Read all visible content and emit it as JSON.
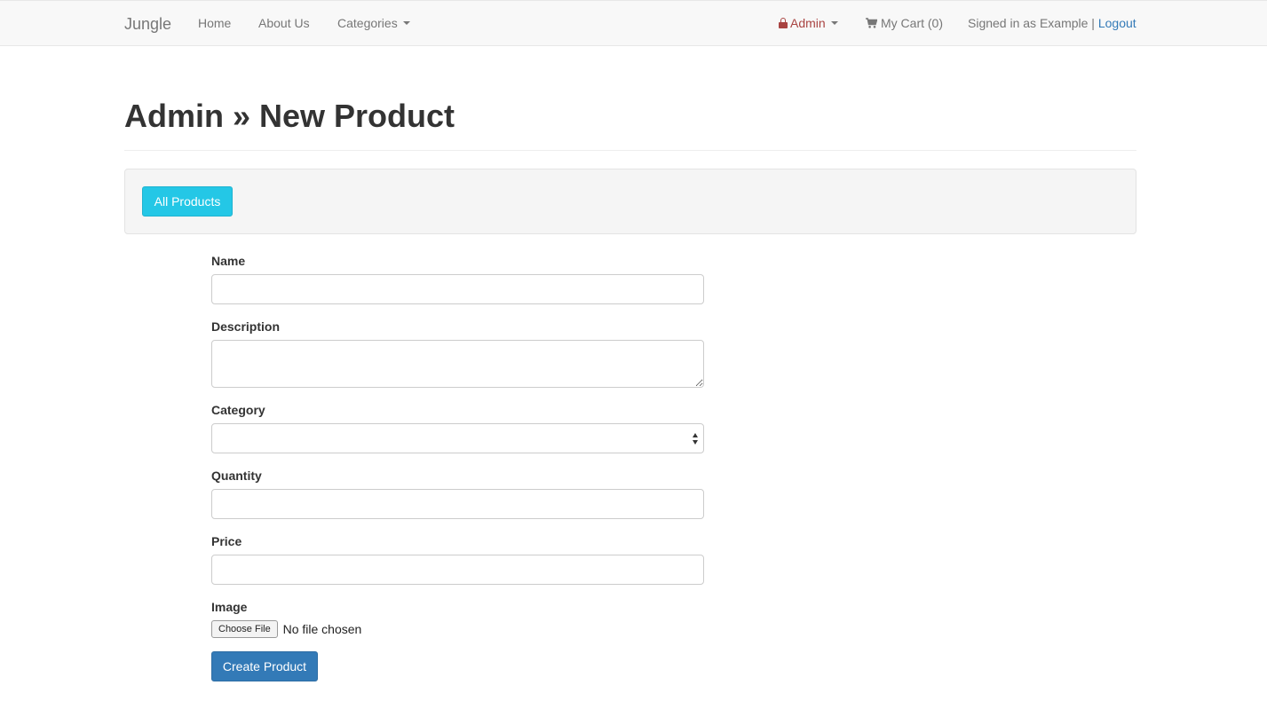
{
  "navbar": {
    "brand": "Jungle",
    "links": {
      "home": "Home",
      "about": "About Us",
      "categories": "Categories"
    },
    "admin": "Admin",
    "cart": "My Cart (0)",
    "signed_in_text": "Signed in as Example |",
    "logout": "Logout"
  },
  "page": {
    "title": "Admin » New Product"
  },
  "toolbar": {
    "all_products": "All Products"
  },
  "form": {
    "name_label": "Name",
    "name_value": "",
    "description_label": "Description",
    "description_value": "",
    "category_label": "Category",
    "category_selected": "",
    "quantity_label": "Quantity",
    "quantity_value": "",
    "price_label": "Price",
    "price_value": "",
    "image_label": "Image",
    "choose_file": "Choose File",
    "file_status": "No file chosen",
    "submit": "Create Product"
  },
  "colors": {
    "admin_text": "#a94442",
    "link": "#337ab7",
    "info_button": "#24c7e6",
    "primary_button": "#337ab7"
  },
  "icons": {
    "admin": "lock-icon",
    "cart": "shopping-cart-icon"
  }
}
